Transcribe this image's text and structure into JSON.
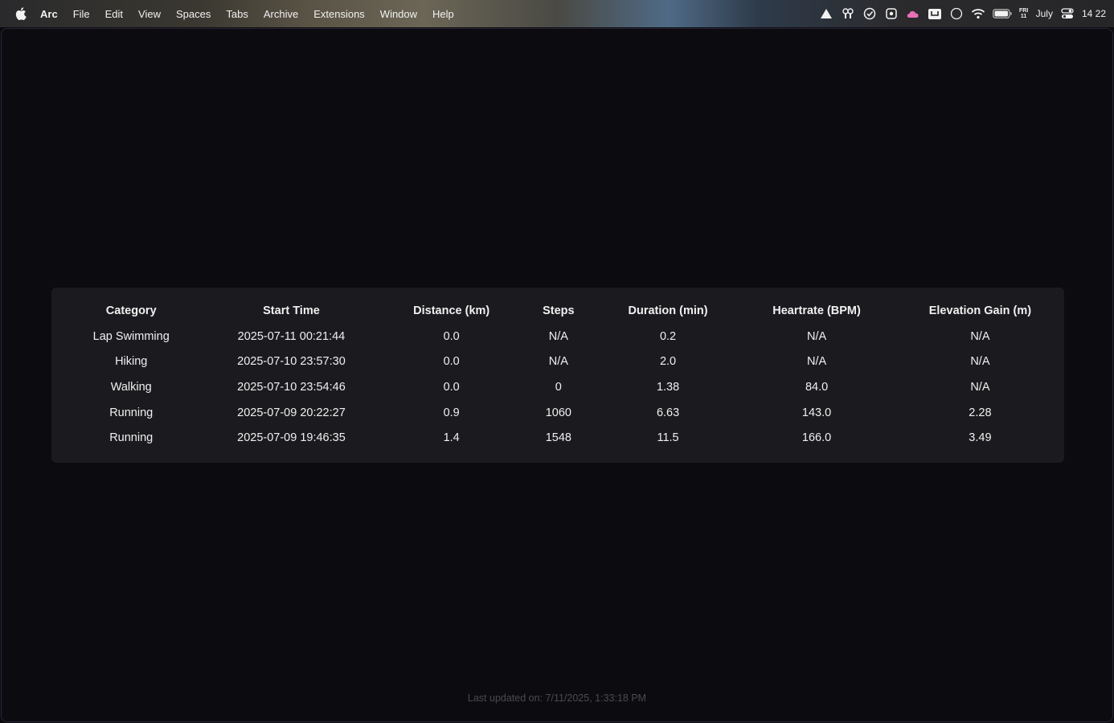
{
  "menubar": {
    "app_name": "Arc",
    "items": [
      "File",
      "Edit",
      "View",
      "Spaces",
      "Tabs",
      "Archive",
      "Extensions",
      "Window",
      "Help"
    ],
    "status_icons": [
      "triangle-icon",
      "fan-icon",
      "check-circle-icon",
      "puzzle-icon",
      "cloud-icon",
      "keyboard-icon",
      "circle-icon",
      "wifi-icon",
      "battery-icon"
    ],
    "day_top": "FRI",
    "day_bottom": "11",
    "month": "July",
    "time": "14 22"
  },
  "table": {
    "headers": [
      "Category",
      "Start Time",
      "Distance (km)",
      "Steps",
      "Duration (min)",
      "Heartrate (BPM)",
      "Elevation Gain (m)"
    ],
    "rows": [
      [
        "Lap Swimming",
        "2025-07-11 00:21:44",
        "0.0",
        "N/A",
        "0.2",
        "N/A",
        "N/A"
      ],
      [
        "Hiking",
        "2025-07-10 23:57:30",
        "0.0",
        "N/A",
        "2.0",
        "N/A",
        "N/A"
      ],
      [
        "Walking",
        "2025-07-10 23:54:46",
        "0.0",
        "0",
        "1.38",
        "84.0",
        "N/A"
      ],
      [
        "Running",
        "2025-07-09 20:22:27",
        "0.9",
        "1060",
        "6.63",
        "143.0",
        "2.28"
      ],
      [
        "Running",
        "2025-07-09 19:46:35",
        "1.4",
        "1548",
        "11.5",
        "166.0",
        "3.49"
      ]
    ]
  },
  "footer": {
    "last_updated": "Last updated on: 7/11/2025, 1:33:18 PM"
  }
}
